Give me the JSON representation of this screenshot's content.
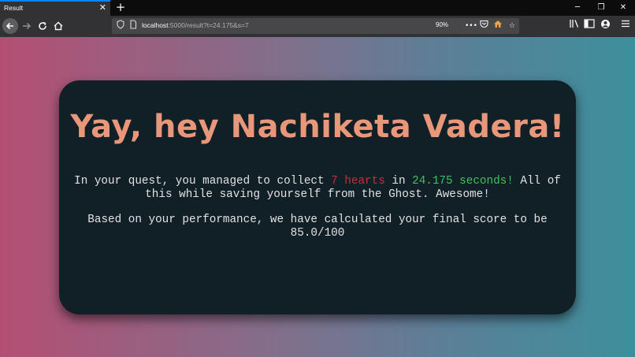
{
  "browser": {
    "tab_title": "Result",
    "tab_close_icon": "close-icon",
    "new_tab_glyph": "+",
    "url_host": "localhost",
    "url_path": ":5000/result?t=24.175&s=7",
    "zoom": "90%",
    "window_controls": [
      "minimize",
      "restore",
      "close"
    ]
  },
  "page": {
    "greeting": "Yay, hey Nachiketa Vadera!",
    "quest": {
      "prefix": "In your quest, you managed to collect ",
      "hearts": "7 hearts",
      "middle": " in ",
      "time": "24.175 seconds!",
      "suffix": " All of this while saving yourself from the Ghost. Awesome!"
    },
    "score_text": "Based on your performance, we have calculated your final score to be 85.0/100"
  },
  "colors": {
    "greeting": "#e9977a",
    "hearts": "#c0303d",
    "time": "#41c161",
    "card_bg": "#111f26",
    "accent": "#0a84ff"
  }
}
